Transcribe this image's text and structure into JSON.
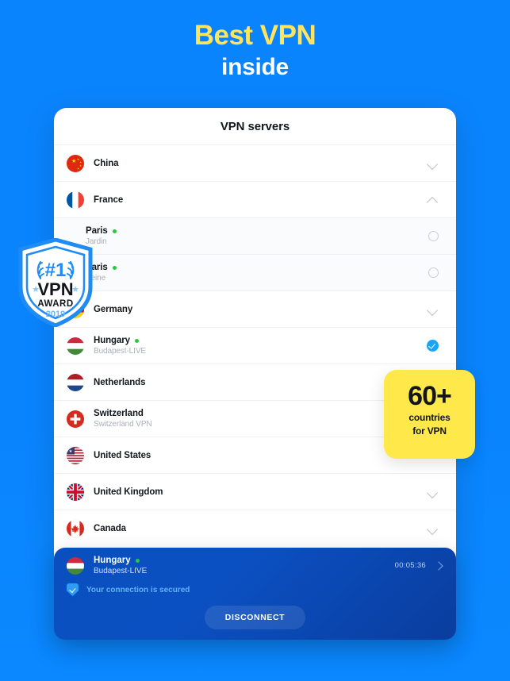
{
  "hero": {
    "line1": "Best VPN",
    "line2": "inside"
  },
  "card": {
    "title": "VPN servers",
    "rows": [
      {
        "name": "China",
        "flag": "cn",
        "sub": "",
        "control": "chevron-down",
        "online": false,
        "type": "country"
      },
      {
        "name": "France",
        "flag": "fr",
        "sub": "",
        "control": "chevron-up",
        "online": false,
        "type": "country"
      },
      {
        "name": "Paris",
        "flag": "",
        "sub": "Jardin",
        "control": "radio",
        "online": true,
        "type": "server"
      },
      {
        "name": "Paris",
        "flag": "",
        "sub": "Seine",
        "control": "radio",
        "online": true,
        "type": "server"
      },
      {
        "name": "Germany",
        "flag": "de",
        "sub": "",
        "control": "chevron-down",
        "online": false,
        "type": "country"
      },
      {
        "name": "Hungary",
        "flag": "hu",
        "sub": "Budapest-LIVE",
        "control": "check",
        "online": true,
        "type": "country"
      },
      {
        "name": "Netherlands",
        "flag": "nl",
        "sub": "",
        "control": "none",
        "online": false,
        "type": "country"
      },
      {
        "name": "Switzerland",
        "flag": "ch",
        "sub": "Switzerland VPN",
        "control": "none",
        "online": false,
        "type": "country"
      },
      {
        "name": "United States",
        "flag": "us",
        "sub": "",
        "control": "none",
        "online": false,
        "type": "country"
      },
      {
        "name": "United Kingdom",
        "flag": "gb",
        "sub": "",
        "control": "chevron-down",
        "online": false,
        "type": "country"
      },
      {
        "name": "Canada",
        "flag": "ca",
        "sub": "",
        "control": "chevron-down",
        "online": false,
        "type": "country"
      }
    ]
  },
  "connection": {
    "country": "Hungary",
    "server": "Budapest-LIVE",
    "timer": "00:05:36",
    "status": "Your connection is secured",
    "button": "DISCONNECT"
  },
  "badge_countries": {
    "number": "60+",
    "line1": "countries",
    "line2": "for VPN"
  },
  "badge_award": {
    "rank": "#1",
    "title": "VPN",
    "subtitle": "AWARD",
    "year": "2019"
  },
  "colors": {
    "background": "#0a84fd",
    "accent_yellow": "#ffe45e",
    "badge_yellow": "#ffe84a",
    "online_dot": "#28c840",
    "check_blue": "#18a5f7",
    "panel_blue": "#0a4fbf"
  }
}
